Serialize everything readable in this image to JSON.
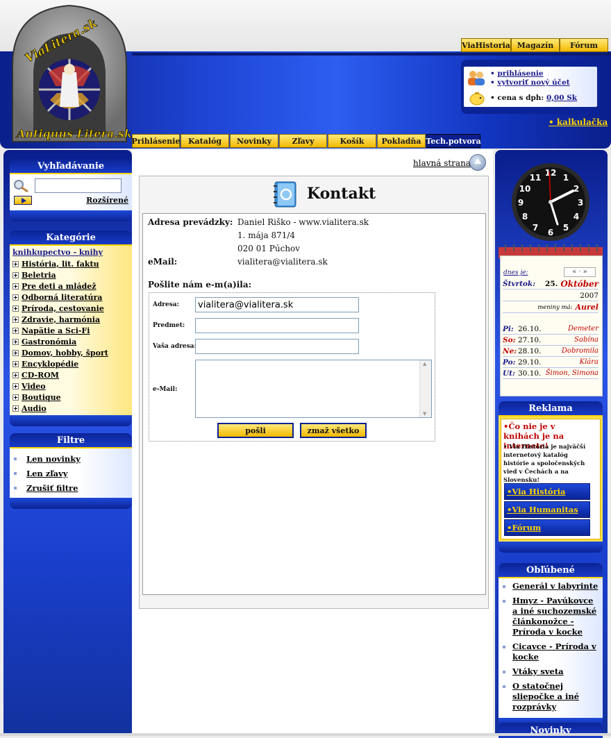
{
  "header": {
    "logo_top_text": "ViaLitera.sk",
    "logo_bottom_text": "Antiquus Litera.sk",
    "top_links": [
      "ViaHistoria",
      "Magazín",
      "Fórum"
    ],
    "user": {
      "login": "prihlásenie",
      "create_account": "vytvoriť nový účet",
      "price_label": "cena s dph:",
      "price_value": "0,00 Sk"
    },
    "calculator": "• kalkulačka",
    "nav": [
      "Prihlásenie",
      "Katalóg",
      "Novinky",
      "Zľavy",
      "Košík",
      "Pokladňa",
      "Tech.potvora"
    ]
  },
  "left": {
    "search": {
      "title": "Vyhľadávanie",
      "advanced": "Rozšírené"
    },
    "categories": {
      "title": "Kategórie",
      "top": "knihkupectvo - knihy",
      "items": [
        "História, lit. faktu",
        "Beletria",
        "Pre deti a mládež",
        "Odborná literatúra",
        "Príroda, cestovanie",
        "Zdravie, harmónia",
        "Napätie a Sci-Fi",
        "Gastronómia",
        "Domov, hobby, šport",
        "Encyklopédie",
        "CD-ROM",
        "Video",
        "Boutique",
        "Audio"
      ]
    },
    "filters": {
      "title": "Filtre",
      "items": [
        "Len novinky",
        "Len zľavy",
        "Zrušiť filtre"
      ]
    }
  },
  "main": {
    "home_link": "hlavná strana",
    "title": "Kontakt",
    "address_label": "Adresa prevádzky:",
    "address_lines": [
      "Daniel Riško - www.vialitera.sk",
      "1. mája 871/4",
      "020 01 Púchov"
    ],
    "email_label": "eMail:",
    "email_value": "vialitera@vialitera.sk",
    "form_heading": "Pošlite nám e-m(a)ila:",
    "form": {
      "to_label": "Adresa:",
      "to_value": "vialitera@vialitera.sk",
      "subject_label": "Predmet:",
      "subject_value": "",
      "from_label": "Vaša adresa:",
      "from_value": "",
      "message_label": "e-Mail:",
      "message_value": "",
      "send": "pošli",
      "clear": "zmaž všetko"
    }
  },
  "right": {
    "calendar": {
      "today_label": "dnes je:",
      "nav": "« · »",
      "weekday": "Štvrtok:",
      "day": "25.",
      "month": "Október",
      "year": "2007",
      "nameday_label": "meniny má:",
      "nameday": "Aurel",
      "rows": [
        {
          "dow": "Pi:",
          "date": "26.10.",
          "name": "Demeter"
        },
        {
          "dow": "So:",
          "date": "27.10.",
          "name": "Sabína"
        },
        {
          "dow": "Ne:",
          "date": "28.10.",
          "name": "Dobromila"
        },
        {
          "dow": "Po:",
          "date": "29.10.",
          "name": "Klára"
        },
        {
          "dow": "Ut:",
          "date": "30.10.",
          "name": "Šimon, Simona"
        }
      ]
    },
    "ads": {
      "title": "Reklama",
      "headline": "•Čo nie je v knihách je na internete!",
      "text": "• Via História je najväčší internetový katalóg histórie a spoločenských vied v Čechách a na Slovensku!",
      "links": [
        "•Via História",
        "•Via Humanitas",
        "•Fórum"
      ]
    },
    "favorites": {
      "title": "Obľúbené",
      "items": [
        "Generál v labyrinte",
        "Hmyz - Pavúkovce a iné suchozemské článkonožce - Príroda v kocke",
        "Cicavce - Príroda v kocke",
        "Vtáky sveta",
        "O statočnej sliepočke a iné rozprávky"
      ]
    },
    "news_title": "Novinky"
  },
  "colors": {
    "brand_blue": "#0b2396",
    "gold": "#ffd400",
    "dark_red": "#c00000"
  }
}
